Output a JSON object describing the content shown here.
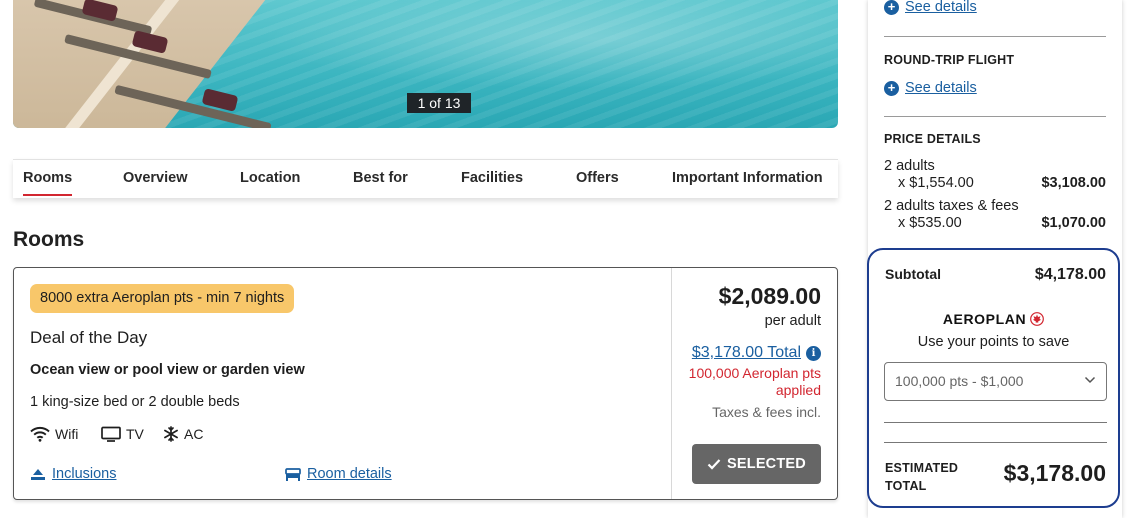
{
  "gallery": {
    "counter": "1 of 13"
  },
  "tabs": [
    {
      "label": "Rooms",
      "active": true
    },
    {
      "label": "Overview"
    },
    {
      "label": "Location"
    },
    {
      "label": "Best for"
    },
    {
      "label": "Facilities"
    },
    {
      "label": "Offers"
    },
    {
      "label": "Important Information"
    }
  ],
  "rooms_heading": "Rooms",
  "room": {
    "promo": "8000 extra Aeroplan pts - min 7 nights",
    "deal": "Deal of the Day",
    "view": "Ocean view or pool view or garden view",
    "beds": "1 king-size bed or 2 double beds",
    "amenities": [
      {
        "icon": "wifi-icon",
        "label": "Wifi"
      },
      {
        "icon": "tv-icon",
        "label": "TV"
      },
      {
        "icon": "snowflake-icon",
        "label": "AC"
      }
    ],
    "inclusions_link": "Inclusions",
    "details_link": "Room details",
    "price": "$2,089.00",
    "price_unit": "per adult",
    "total_link": "$3,178.00 Total",
    "points_applied": "100,000 Aeroplan pts applied",
    "taxes_note": "Taxes & fees incl.",
    "selected_button": "SELECTED"
  },
  "sidebar": {
    "hotel_link": "See details",
    "flight_heading": "ROUND-TRIP FLIGHT",
    "flight_link": "See details",
    "price_heading": "PRICE DETAILS",
    "lines": [
      {
        "label": "2 adults",
        "sub": "x $1,554.00",
        "amount": "$3,108.00"
      },
      {
        "label": "2 adults taxes & fees",
        "sub": "x $535.00",
        "amount": "$1,070.00"
      }
    ],
    "subtotal_label": "Subtotal",
    "subtotal_value": "$4,178.00",
    "aeroplan_brand": "AEROPLAN",
    "points_prompt": "Use your points to save",
    "points_select": "100,000 pts - $1,000",
    "estimated_label_1": "ESTIMATED",
    "estimated_label_2": "TOTAL",
    "estimated_value": "$3,178.00"
  },
  "colors": {
    "accent_red": "#d22630",
    "link_blue": "#1a5fa0",
    "promo_yellow": "#f8c76a",
    "box_navy": "#1d3d8f",
    "button_gray": "#666666"
  }
}
